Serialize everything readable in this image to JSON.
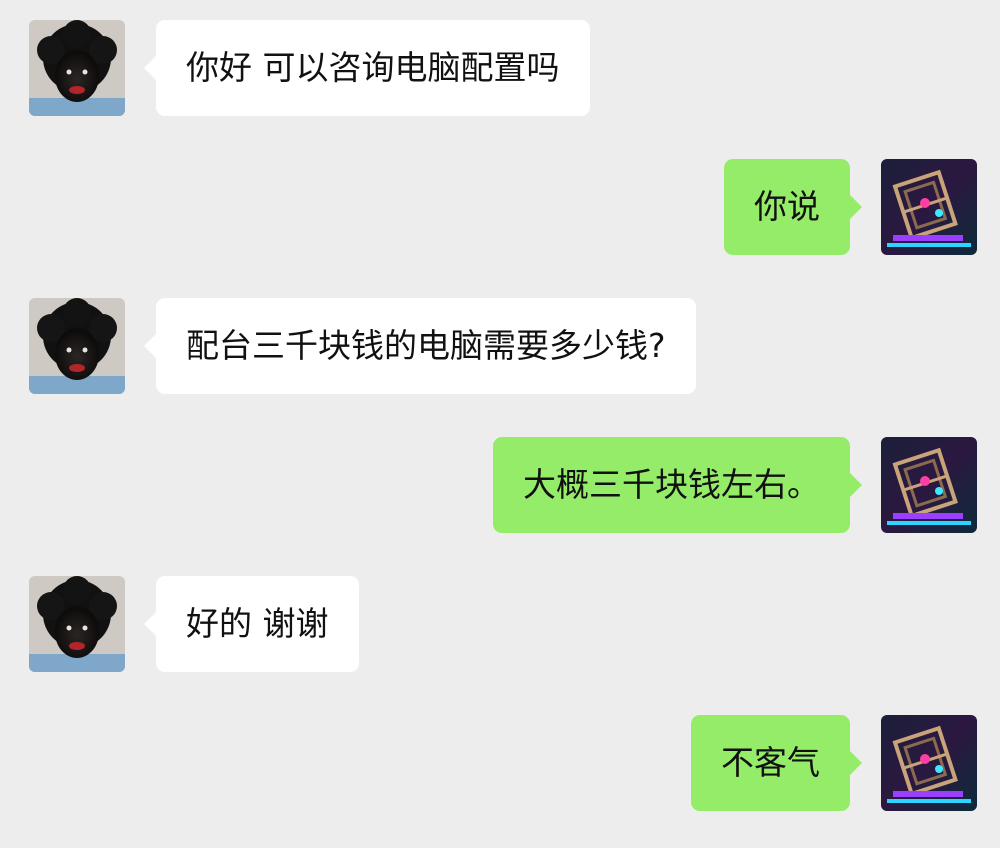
{
  "chat": {
    "messages": [
      {
        "side": "left",
        "text": "你好 可以咨询电脑配置吗"
      },
      {
        "side": "right",
        "text": "你说"
      },
      {
        "side": "left",
        "text": "配台三千块钱的电脑需要多少钱?"
      },
      {
        "side": "right",
        "text": "大概三千块钱左右。"
      },
      {
        "side": "left",
        "text": "好的 谢谢"
      },
      {
        "side": "right",
        "text": "不客气"
      }
    ]
  },
  "colors": {
    "background": "#ededed",
    "incoming_bubble": "#ffffff",
    "outgoing_bubble": "#95ec69",
    "text": "#111111"
  }
}
